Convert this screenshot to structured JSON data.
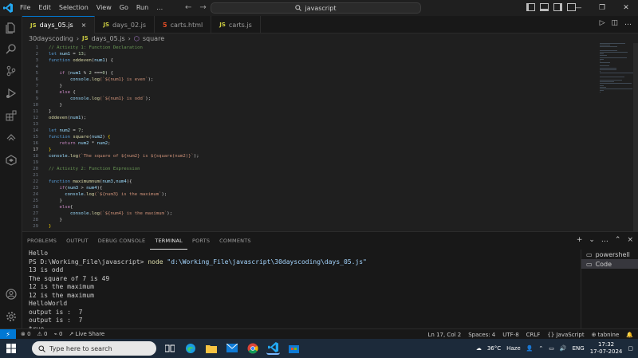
{
  "titlebar": {
    "menu": [
      "File",
      "Edit",
      "Selection",
      "View",
      "Go",
      "Run",
      "…"
    ],
    "search_text": "javascript"
  },
  "tabs": [
    {
      "icon": "JS",
      "label": "days_05.js",
      "active": true,
      "close": "×"
    },
    {
      "icon": "JS",
      "label": "days_02.js",
      "active": false
    },
    {
      "icon": "5",
      "label": "carts.html",
      "active": false
    },
    {
      "icon": "JS",
      "label": "carts.js",
      "active": false
    }
  ],
  "breadcrumb": {
    "folder": "30dayscoding",
    "file_icon": "JS",
    "file": "days_05.js",
    "symbol": "square"
  },
  "editor": {
    "current_line": 17,
    "lines": [
      {
        "n": "1",
        "tokens": [
          {
            "t": "// Activity 1: Function Declaration",
            "c": "cm"
          }
        ]
      },
      {
        "n": "2",
        "tokens": [
          {
            "t": "let ",
            "c": "kw"
          },
          {
            "t": "num1",
            "c": "var"
          },
          {
            "t": " = ",
            "c": "pl"
          },
          {
            "t": "13",
            "c": "num"
          },
          {
            "t": ";",
            "c": "pl"
          }
        ]
      },
      {
        "n": "3",
        "tokens": [
          {
            "t": "function ",
            "c": "kw"
          },
          {
            "t": "oddeven",
            "c": "fn"
          },
          {
            "t": "(",
            "c": "pl"
          },
          {
            "t": "num1",
            "c": "var"
          },
          {
            "t": ") {",
            "c": "pl"
          }
        ]
      },
      {
        "n": "4",
        "tokens": []
      },
      {
        "n": "5",
        "tokens": [
          {
            "t": "    if ",
            "c": "kw2"
          },
          {
            "t": "(",
            "c": "pl"
          },
          {
            "t": "num1",
            "c": "var"
          },
          {
            "t": " % ",
            "c": "pl"
          },
          {
            "t": "2",
            "c": "num"
          },
          {
            "t": " ===",
            "c": "pl"
          },
          {
            "t": "0",
            "c": "num"
          },
          {
            "t": ") {",
            "c": "pl"
          }
        ]
      },
      {
        "n": "6",
        "tokens": [
          {
            "t": "        console",
            "c": "var"
          },
          {
            "t": ".",
            "c": "pl"
          },
          {
            "t": "log",
            "c": "fn"
          },
          {
            "t": "(`${num1} is even`",
            "c": "str"
          },
          {
            "t": ");",
            "c": "pl"
          }
        ]
      },
      {
        "n": "7",
        "tokens": [
          {
            "t": "    }",
            "c": "pl"
          }
        ]
      },
      {
        "n": "8",
        "tokens": [
          {
            "t": "    else ",
            "c": "kw2"
          },
          {
            "t": "{",
            "c": "pl"
          }
        ]
      },
      {
        "n": "9",
        "tokens": [
          {
            "t": "        console",
            "c": "var"
          },
          {
            "t": ".",
            "c": "pl"
          },
          {
            "t": "log",
            "c": "fn"
          },
          {
            "t": "(`${num1} is odd`",
            "c": "str"
          },
          {
            "t": ");",
            "c": "pl"
          }
        ]
      },
      {
        "n": "10",
        "tokens": [
          {
            "t": "    }",
            "c": "pl"
          }
        ]
      },
      {
        "n": "11",
        "tokens": [
          {
            "t": "}",
            "c": "pl"
          }
        ]
      },
      {
        "n": "12",
        "tokens": [
          {
            "t": "oddeven",
            "c": "fn"
          },
          {
            "t": "(",
            "c": "pl"
          },
          {
            "t": "num1",
            "c": "var"
          },
          {
            "t": ");",
            "c": "pl"
          }
        ]
      },
      {
        "n": "13",
        "tokens": []
      },
      {
        "n": "14",
        "tokens": [
          {
            "t": "let ",
            "c": "kw"
          },
          {
            "t": "num2",
            "c": "var"
          },
          {
            "t": " = ",
            "c": "pl"
          },
          {
            "t": "7",
            "c": "num"
          },
          {
            "t": ";",
            "c": "pl"
          }
        ]
      },
      {
        "n": "15",
        "tokens": [
          {
            "t": "function ",
            "c": "kw"
          },
          {
            "t": "square",
            "c": "fn"
          },
          {
            "t": "(",
            "c": "pl"
          },
          {
            "t": "num2",
            "c": "var"
          },
          {
            "t": ") ",
            "c": "pl"
          },
          {
            "t": "{",
            "c": "br"
          }
        ]
      },
      {
        "n": "16",
        "tokens": [
          {
            "t": "    return ",
            "c": "kw2"
          },
          {
            "t": "num2",
            "c": "var"
          },
          {
            "t": " * ",
            "c": "pl"
          },
          {
            "t": "num2",
            "c": "var"
          },
          {
            "t": ";",
            "c": "pl"
          }
        ]
      },
      {
        "n": "17",
        "tokens": [
          {
            "t": "}",
            "c": "br"
          }
        ]
      },
      {
        "n": "18",
        "tokens": [
          {
            "t": "console",
            "c": "var"
          },
          {
            "t": ".",
            "c": "pl"
          },
          {
            "t": "log",
            "c": "fn"
          },
          {
            "t": "(`The square of ${num2} is ${square(num2)}`",
            "c": "str"
          },
          {
            "t": ");",
            "c": "pl"
          }
        ]
      },
      {
        "n": "19",
        "tokens": []
      },
      {
        "n": "20",
        "tokens": [
          {
            "t": "// Activity 2: Function Expression",
            "c": "cm"
          }
        ]
      },
      {
        "n": "21",
        "tokens": []
      },
      {
        "n": "22",
        "tokens": [
          {
            "t": "function ",
            "c": "kw"
          },
          {
            "t": "maximumnum",
            "c": "fn"
          },
          {
            "t": "(",
            "c": "pl"
          },
          {
            "t": "num3",
            "c": "var"
          },
          {
            "t": ",",
            "c": "pl"
          },
          {
            "t": "num4",
            "c": "var"
          },
          {
            "t": "){",
            "c": "pl"
          }
        ]
      },
      {
        "n": "23",
        "tokens": [
          {
            "t": "    if",
            "c": "kw2"
          },
          {
            "t": "(",
            "c": "pl"
          },
          {
            "t": "num3",
            "c": "var"
          },
          {
            "t": " > ",
            "c": "pl"
          },
          {
            "t": "num4",
            "c": "var"
          },
          {
            "t": "){",
            "c": "pl"
          }
        ]
      },
      {
        "n": "24",
        "tokens": [
          {
            "t": "      console",
            "c": "var"
          },
          {
            "t": ".",
            "c": "pl"
          },
          {
            "t": "log",
            "c": "fn"
          },
          {
            "t": "(`${num3} is the maximum`",
            "c": "str"
          },
          {
            "t": ");",
            "c": "pl"
          }
        ]
      },
      {
        "n": "25",
        "tokens": [
          {
            "t": "    }",
            "c": "pl"
          }
        ]
      },
      {
        "n": "26",
        "tokens": [
          {
            "t": "    else",
            "c": "kw2"
          },
          {
            "t": "{",
            "c": "pl"
          }
        ]
      },
      {
        "n": "27",
        "tokens": [
          {
            "t": "        console",
            "c": "var"
          },
          {
            "t": ".",
            "c": "pl"
          },
          {
            "t": "log",
            "c": "fn"
          },
          {
            "t": "(`${num4} is the maximum`",
            "c": "str"
          },
          {
            "t": ");",
            "c": "pl"
          }
        ]
      },
      {
        "n": "28",
        "tokens": [
          {
            "t": "    }",
            "c": "pl"
          }
        ]
      },
      {
        "n": "29",
        "tokens": [
          {
            "t": "}",
            "c": "br"
          }
        ]
      }
    ]
  },
  "panel": {
    "tabs": [
      "PROBLEMS",
      "OUTPUT",
      "DEBUG CONSOLE",
      "TERMINAL",
      "PORTS",
      "COMMENTS"
    ],
    "active_tab": "TERMINAL",
    "actions": [
      "+",
      "⌄",
      "…",
      "⌃",
      "×"
    ],
    "terminal_lines": [
      "Hello",
      "PS D:\\Working_File\\javascript> ",
      "13 is odd",
      "The square of 7 is 49",
      "12 is the maximum",
      "12 is the maximum",
      "HelloWorld",
      "output is :  7",
      "output is :  7",
      "true"
    ],
    "prompt_command": "node",
    "prompt_arg": " \"d:\\Working_File\\javascript\\30dayscoding\\days_05.js\"",
    "terminal_list": [
      {
        "label": "powershell",
        "active": false
      },
      {
        "label": "Code",
        "active": true
      }
    ]
  },
  "statusbar": {
    "remote_icon": "⚡",
    "errors": "⊗ 0",
    "warnings": "⚠ 0",
    "ports": "⌁ 0",
    "live_share": "Live Share",
    "position": "Ln 17, Col 2",
    "spaces": "Spaces: 4",
    "encoding": "UTF-8",
    "eol": "CRLF",
    "language": "{} JavaScript",
    "tabnine": "⊕ tabnine",
    "bell": "🔔"
  },
  "taskbar": {
    "search_placeholder": "Type here to search",
    "weather_temp": "36°C",
    "weather_text": "Haze",
    "language": "ENG",
    "time": "17:32",
    "date": "17-07-2024"
  },
  "colors": {
    "accent": "#0078d4",
    "editor_bg": "#1f1f1f",
    "panel_bg": "#181818"
  }
}
